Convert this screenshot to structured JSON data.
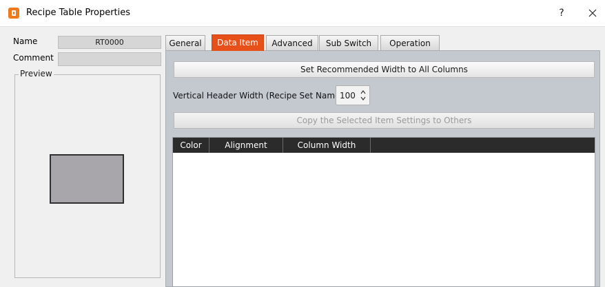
{
  "window": {
    "title": "Recipe Table Properties",
    "help": "?"
  },
  "left": {
    "name_label": "Name",
    "name_value": "RT0000",
    "comment_label": "Comment",
    "comment_value": "",
    "preview_label": "Preview"
  },
  "tabs": [
    {
      "label": "General",
      "active": false
    },
    {
      "label": "Data Item",
      "active": true
    },
    {
      "label": "Advanced",
      "active": false
    },
    {
      "label": "Sub Switch",
      "active": false
    },
    {
      "label": "Operation",
      "active": false
    }
  ],
  "data_item": {
    "set_width_button": "Set Recommended Width to All Columns",
    "vertical_header_label": "Vertical Header Width (Recipe Set Name):",
    "vertical_header_value": "100",
    "copy_settings_button": "Copy the Selected Item Settings to Others",
    "columns": [
      "Color",
      "Alignment",
      "Column Width"
    ]
  },
  "colors": {
    "accent": "#e8501a",
    "table_header": "#2b2b2b",
    "panel": "#c4c8cf"
  }
}
